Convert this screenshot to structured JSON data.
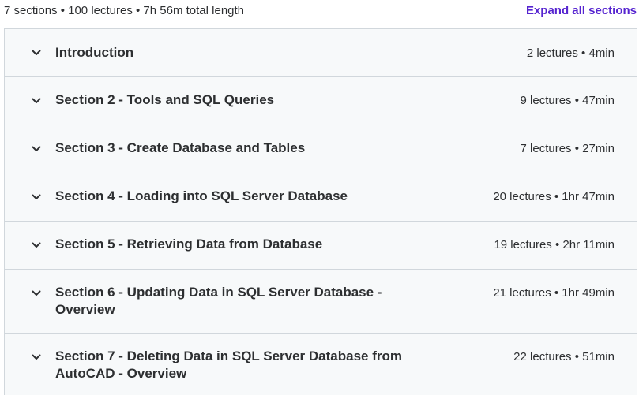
{
  "curriculum": {
    "summary": "7 sections • 100 lectures • 7h 56m total length",
    "expand_label": "Expand all sections",
    "accent_color": "#5624d0",
    "sections": [
      {
        "title": "Introduction",
        "meta": "2 lectures • 4min",
        "icon": "chevron-down-icon"
      },
      {
        "title": "Section 2 - Tools and SQL Queries",
        "meta": "9 lectures • 47min",
        "icon": "chevron-down-icon"
      },
      {
        "title": "Section 3 - Create Database and Tables",
        "meta": "7 lectures • 27min",
        "icon": "chevron-down-icon"
      },
      {
        "title": "Section 4 - Loading into SQL Server Database",
        "meta": "20 lectures • 1hr 47min",
        "icon": "chevron-down-icon"
      },
      {
        "title": "Section 5 - Retrieving Data from Database",
        "meta": "19 lectures • 2hr 11min",
        "icon": "chevron-down-icon"
      },
      {
        "title": "Section 6 - Updating Data in SQL Server Database - Overview",
        "meta": "21 lectures • 1hr 49min",
        "icon": "chevron-down-icon"
      },
      {
        "title": "Section 7 - Deleting Data in SQL Server Database from AutoCAD - Overview",
        "meta": "22 lectures • 51min",
        "icon": "chevron-down-icon"
      }
    ]
  }
}
